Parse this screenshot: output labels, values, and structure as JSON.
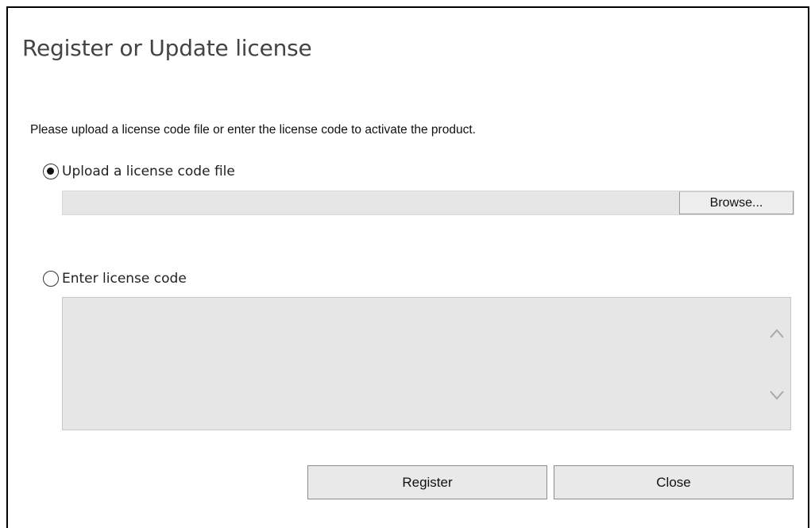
{
  "dialog": {
    "title": "Register or Update license",
    "instruction": "Please upload a license code file or enter the license code to activate the product.",
    "options": [
      {
        "label": "Upload a license code file",
        "selected": true
      },
      {
        "label": "Enter license code",
        "selected": false
      }
    ],
    "file_upload": {
      "value": "",
      "browse_label": "Browse..."
    },
    "license_code": {
      "value": "",
      "scroll_up_icon": "chevron-up-icon",
      "scroll_down_icon": "chevron-down-icon"
    },
    "buttons": {
      "register_label": "Register",
      "close_label": "Close"
    }
  }
}
